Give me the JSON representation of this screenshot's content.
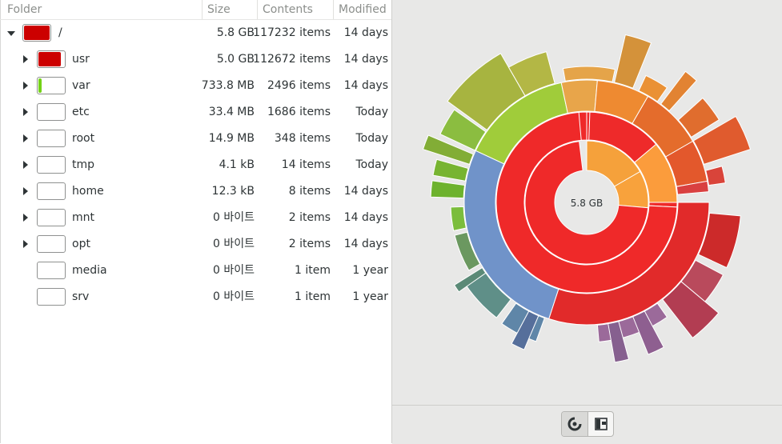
{
  "columns": {
    "folder": "Folder",
    "size": "Size",
    "contents": "Contents",
    "modified": "Modified"
  },
  "rows": [
    {
      "name": "/",
      "size": "5.8 GB",
      "contents": "117232 items",
      "modified": "14 days",
      "expander": "expanded",
      "usage": 1.0,
      "indent": 0
    },
    {
      "name": "usr",
      "size": "5.0 GB",
      "contents": "112672 items",
      "modified": "14 days",
      "expander": "collapsed",
      "usage": 0.86,
      "indent": 1
    },
    {
      "name": "var",
      "size": "733.8 MB",
      "contents": "2496 items",
      "modified": "14 days",
      "expander": "collapsed",
      "usage": 0.12,
      "indent": 1
    },
    {
      "name": "etc",
      "size": "33.4 MB",
      "contents": "1686 items",
      "modified": "Today",
      "expander": "collapsed",
      "usage": 0.0,
      "indent": 1
    },
    {
      "name": "root",
      "size": "14.9 MB",
      "contents": "348 items",
      "modified": "Today",
      "expander": "collapsed",
      "usage": 0.0,
      "indent": 1
    },
    {
      "name": "tmp",
      "size": "4.1 kB",
      "contents": "14 items",
      "modified": "Today",
      "expander": "collapsed",
      "usage": 0.0,
      "indent": 1
    },
    {
      "name": "home",
      "size": "12.3 kB",
      "contents": "8 items",
      "modified": "14 days",
      "expander": "collapsed",
      "usage": 0.0,
      "indent": 1
    },
    {
      "name": "mnt",
      "size": "0 바이트",
      "contents": "2 items",
      "modified": "14 days",
      "expander": "collapsed",
      "usage": 0.0,
      "indent": 1
    },
    {
      "name": "opt",
      "size": "0 바이트",
      "contents": "2 items",
      "modified": "14 days",
      "expander": "collapsed",
      "usage": 0.0,
      "indent": 1
    },
    {
      "name": "media",
      "size": "0 바이트",
      "contents": "1 item",
      "modified": "1 year",
      "expander": "none",
      "usage": 0.0,
      "indent": 1
    },
    {
      "name": "srv",
      "size": "0 바이트",
      "contents": "1 item",
      "modified": "1 year",
      "expander": "none",
      "usage": 0.0,
      "indent": 1
    }
  ],
  "colors": {
    "root_fill": "#cc0000",
    "usr_fill": "#cc0000",
    "var_fill": "#73d216"
  },
  "chart": {
    "center_label": "5.8 GB",
    "rings": [
      [
        {
          "start": -90,
          "end": 260,
          "color": "#ef2929"
        },
        {
          "start": 260,
          "end": 262,
          "color": "#ffffff"
        },
        {
          "start": 262,
          "end": 270,
          "color": "#ef2929"
        }
      ]
    ]
  },
  "view_buttons": {
    "chart_icon": "ring-chart-icon",
    "treemap_icon": "treemap-icon"
  }
}
